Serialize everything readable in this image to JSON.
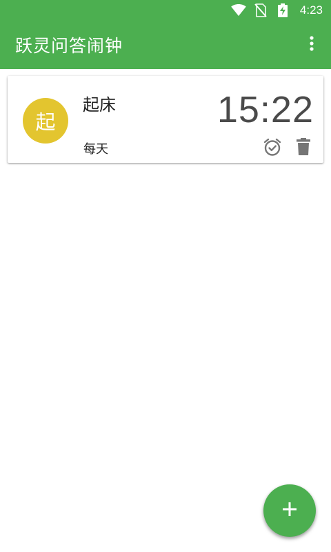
{
  "status_bar": {
    "time": "4:23",
    "icons": [
      "wifi-icon",
      "no-sim-icon",
      "battery-charging-icon"
    ]
  },
  "app_bar": {
    "title": "跃灵问答闹钟",
    "overflow_icon": "more-vert-icon"
  },
  "alarms": [
    {
      "avatar_text": "起",
      "avatar_color": "#e3c52f",
      "label": "起床",
      "time": "15:22",
      "repeat": "每天",
      "toggle_icon": "alarm-check-icon",
      "delete_icon": "trash-icon"
    }
  ],
  "fab": {
    "icon": "plus-icon"
  },
  "colors": {
    "primary": "#4caf50",
    "icon_gray": "#757575",
    "text_dark": "#222222"
  }
}
